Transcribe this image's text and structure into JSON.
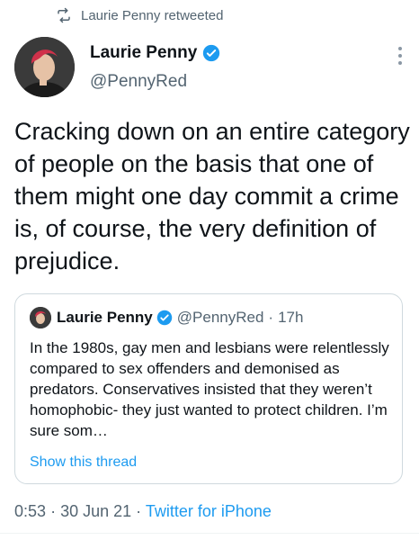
{
  "retweet": {
    "label": "Laurie Penny retweeted",
    "icon": "retweet-icon"
  },
  "tweet": {
    "author": {
      "name": "Laurie Penny",
      "handle": "@PennyRed",
      "verified_icon": "verified-badge-icon"
    },
    "text": "Cracking down on an entire category of people on the basis that one of them might one day commit a crime is, of course, the very definition of prejudice."
  },
  "quote": {
    "author": {
      "name": "Laurie Penny",
      "handle": "@PennyRed"
    },
    "separator": "·",
    "time": "17h",
    "text": "In the 1980s, gay men and lesbians were relentlessly compared to sex offenders and demonised as predators. Conservatives insisted that they weren’t homophobic- they just wanted to protect children. I’m sure som…",
    "show_thread": "Show this thread"
  },
  "footer": {
    "time": "0:53",
    "sep1": "·",
    "date": "30 Jun 21",
    "sep2": "·",
    "source": "Twitter for iPhone"
  },
  "colors": {
    "accent": "#1d9bf0",
    "muted": "#536471",
    "text": "#0f1419",
    "border": "#cfd9de"
  }
}
